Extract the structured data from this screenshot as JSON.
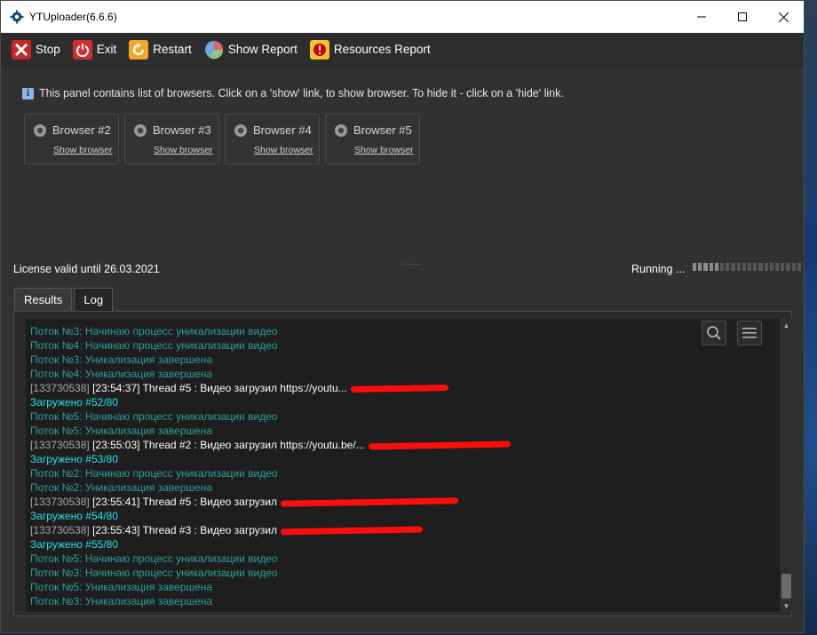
{
  "window": {
    "title": "YTUploader(6.6.6)"
  },
  "toolbar": {
    "stop": "Stop",
    "exit": "Exit",
    "restart": "Restart",
    "show_report": "Show Report",
    "resources_report": "Resources Report"
  },
  "panel": {
    "info": "This panel contains list of browsers. Click on a 'show' link, to show browser. To hide it - click on a 'hide' link.",
    "browsers": [
      {
        "name": "Browser #2",
        "link": "Show browser"
      },
      {
        "name": "Browser #3",
        "link": "Show browser"
      },
      {
        "name": "Browser #4",
        "link": "Show browser"
      },
      {
        "name": "Browser #5",
        "link": "Show browser"
      }
    ],
    "splitter": "......"
  },
  "status": {
    "license": "License valid until 26.03.2021",
    "running": "Running ...",
    "progress_segments_active": 5,
    "progress_segments_total": 20
  },
  "tabs": [
    {
      "label": "Results"
    },
    {
      "label": "Log"
    }
  ],
  "log": {
    "lines": [
      {
        "type": "info",
        "text": "Поток №3: Начинаю процесс уникализации видео"
      },
      {
        "type": "info",
        "text": "Поток №4: Начинаю процесс уникализации видео"
      },
      {
        "type": "info",
        "text": "Поток №3: Уникализация завершена"
      },
      {
        "type": "info",
        "text": "Поток №4: Уникализация завершена"
      },
      {
        "type": "upload",
        "id": "[133730538]",
        "text": "[23:54:37] Thread #5 : Видео загрузил https://youtu..."
      },
      {
        "type": "load",
        "text": "Загружено #52/80"
      },
      {
        "type": "info",
        "text": "Поток №5: Начинаю процесс уникализации видео"
      },
      {
        "type": "info",
        "text": "Поток №5: Уникализация завершена"
      },
      {
        "type": "upload",
        "id": "[133730538]",
        "text": "[23:55:03] Thread #2 : Видео загрузил https://youtu.be/..."
      },
      {
        "type": "load",
        "text": "Загружено #53/80"
      },
      {
        "type": "info",
        "text": "Поток №2: Начинаю процесс уникализации видео"
      },
      {
        "type": "info",
        "text": "Поток №2: Уникализация завершена"
      },
      {
        "type": "upload",
        "id": "[133730538]",
        "text": "[23:55:41] Thread #5 : Видео загрузил"
      },
      {
        "type": "load",
        "text": "Загружено #54/80"
      },
      {
        "type": "upload",
        "id": "[133730538]",
        "text": "[23:55:43] Thread #3 : Видео загрузил"
      },
      {
        "type": "load",
        "text": "Загружено #55/80"
      },
      {
        "type": "info",
        "text": "Поток №5: Начинаю процесс уникализации видео"
      },
      {
        "type": "info",
        "text": "Поток №3: Начинаю процесс уникализации видео"
      },
      {
        "type": "info",
        "text": "Поток №5: Уникализация завершена"
      },
      {
        "type": "info",
        "text": "Поток №3: Уникализация завершена"
      }
    ]
  },
  "colors": {
    "log_info": "#2aa198",
    "log_loaded": "#28e0ea",
    "redaction": "#ff0d0d",
    "window_bg": "#313131"
  },
  "icons": {
    "app": "gear-icon",
    "stop": "stop-x-icon",
    "exit": "power-icon",
    "restart": "restart-icon",
    "show_report": "pie-chart-icon",
    "resources_report": "warning-report-icon",
    "browser": "chrome-icon",
    "search": "search-icon",
    "menu": "menu-icon"
  }
}
